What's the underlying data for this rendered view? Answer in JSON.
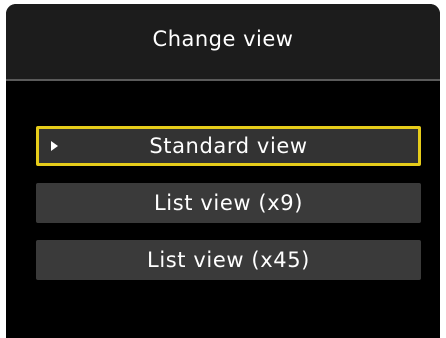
{
  "header": {
    "title": "Change view"
  },
  "menu": {
    "selected_index": 0,
    "items": [
      {
        "label": "Standard view"
      },
      {
        "label": "List view (x9)"
      },
      {
        "label": "List view (x45)"
      }
    ]
  },
  "colors": {
    "screen_background": "#000000",
    "header_background": "#1c1c1c",
    "item_background": "#3a3a3a",
    "selection_border": "#e6cc1a",
    "text": "#ffffff"
  },
  "icons": {
    "selection_cursor": "right-triangle-icon"
  }
}
